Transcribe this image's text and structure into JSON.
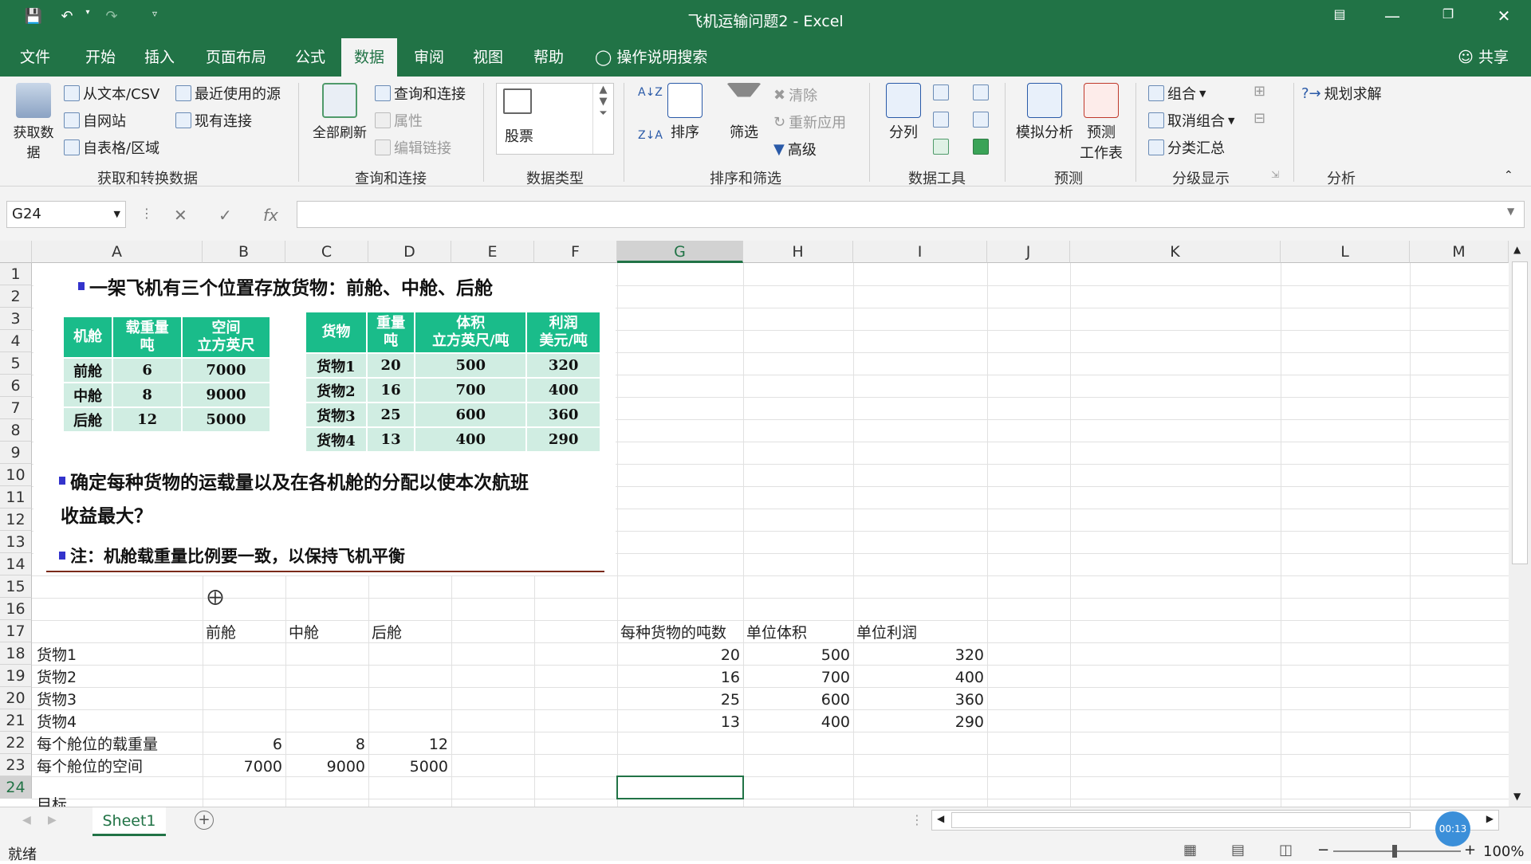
{
  "window": {
    "title": "飞机运输问题2  -  Excel"
  },
  "tabs": [
    "文件",
    "开始",
    "插入",
    "页面布局",
    "公式",
    "数据",
    "审阅",
    "视图",
    "帮助"
  ],
  "tell_me": "操作说明搜索",
  "share": "共享",
  "ribbon": {
    "get_data": "获取数据",
    "from_text": "从文本/CSV",
    "from_web": "自网站",
    "from_table": "自表格/区域",
    "recent_sources": "最近使用的源",
    "existing_conn": "现有连接",
    "group1": "获取和转换数据",
    "refresh_all": "全部刷新",
    "queries_conn": "查询和连接",
    "properties": "属性",
    "edit_links": "编辑链接",
    "group2": "查询和连接",
    "stocks": "股票",
    "group3": "数据类型",
    "sort": "排序",
    "filter": "筛选",
    "clear": "清除",
    "reapply": "重新应用",
    "advanced": "高级",
    "group4": "排序和筛选",
    "text_to_cols": "分列",
    "group5": "数据工具",
    "what_if": "模拟分析",
    "forecast": "预测",
    "forecast2": "工作表",
    "group6": "预测",
    "group_btn": "组合",
    "ungroup_btn": "取消组合",
    "subtotal": "分类汇总",
    "group7": "分级显示",
    "solver": "规划求解",
    "group8": "分析"
  },
  "namebox": "G24",
  "columns": [
    "A",
    "B",
    "C",
    "D",
    "E",
    "F",
    "G",
    "H",
    "I",
    "J",
    "K",
    "L",
    "M"
  ],
  "rows": [
    "1",
    "2",
    "3",
    "4",
    "5",
    "6",
    "7",
    "8",
    "9",
    "10",
    "11",
    "12",
    "13",
    "14",
    "15",
    "16",
    "17",
    "18",
    "19",
    "20",
    "21",
    "22",
    "23",
    "24"
  ],
  "problem": {
    "line1": "一架飞机有三个位置存放货物：前舱、中舱、后舱",
    "line2a": "确定每种货物的运载量以及在各机舱的分配以使本次航班",
    "line2b": "收益最大？",
    "line3": "注：机舱载重量比例要一致，以保持飞机平衡"
  },
  "cabin_table": {
    "headers": [
      [
        "机舱"
      ],
      [
        "载重量",
        "吨"
      ],
      [
        "空间",
        "立方英尺"
      ]
    ],
    "rows": [
      [
        "前舱",
        "6",
        "7000"
      ],
      [
        "中舱",
        "8",
        "9000"
      ],
      [
        "后舱",
        "12",
        "5000"
      ]
    ]
  },
  "cargo_table": {
    "headers": [
      [
        "货物"
      ],
      [
        "重量",
        "吨"
      ],
      [
        "体积",
        "立方英尺/吨"
      ],
      [
        "利润",
        "美元/吨"
      ]
    ],
    "rows": [
      [
        "货物1",
        "20",
        "500",
        "320"
      ],
      [
        "货物2",
        "16",
        "700",
        "400"
      ],
      [
        "货物3",
        "25",
        "600",
        "360"
      ],
      [
        "货物4",
        "13",
        "400",
        "290"
      ]
    ]
  },
  "sheet": {
    "b17": "前舱",
    "c17": "中舱",
    "d17": "后舱",
    "a18": "货物1",
    "a19": "货物2",
    "a20": "货物3",
    "a21": "货物4",
    "a22": "每个舱位的载重量",
    "b22": "6",
    "c22": "8",
    "d22": "12",
    "a23": "每个舱位的空间",
    "b23": "7000",
    "c23": "9000",
    "d23": "5000",
    "g17": "每种货物的吨数",
    "h17": "单位体积",
    "i17": "单位利润",
    "g18": "20",
    "h18": "500",
    "i18": "320",
    "g19": "16",
    "h19": "700",
    "i19": "400",
    "g20": "25",
    "h20": "600",
    "i20": "360",
    "g21": "13",
    "h21": "400",
    "i21": "290",
    "a25": "目标"
  },
  "sheet_tab": "Sheet1",
  "status": {
    "ready": "就绪",
    "zoom": "100%",
    "timer": "00:13"
  },
  "colors": {
    "accent": "#217346",
    "table_header": "#1abc8a",
    "table_body": "#d0ede2"
  }
}
